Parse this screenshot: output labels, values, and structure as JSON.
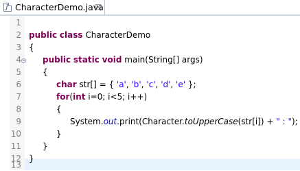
{
  "tab": {
    "title": "CharacterDemo.java",
    "close": "☒",
    "icon_letter": "J"
  },
  "line_numbers": [
    "1",
    "2",
    "3",
    "4",
    "5",
    "6",
    "7",
    "8",
    "9",
    "10",
    "11",
    "12",
    "13"
  ],
  "code": {
    "l2": {
      "kw1": "public",
      "kw2": "class",
      "name": "CharacterDemo"
    },
    "l3": {
      "text": "{"
    },
    "l4": {
      "kw1": "public",
      "kw2": "static",
      "kw3": "void",
      "rest": "main(String[] args)"
    },
    "l5": {
      "text": "{"
    },
    "l6": {
      "kw": "char",
      "pre": "str[] = { ",
      "s1": "'a'",
      "c1": ", ",
      "s2": "'b'",
      "c2": ", ",
      "s3": "'c'",
      "c3": ", ",
      "s4": "'d'",
      "c4": ", ",
      "s5": "'e'",
      "post": " };"
    },
    "l7": {
      "kw1": "for",
      "p1": "(",
      "kw2": "int",
      "rest": " i=0; i<5; i++)"
    },
    "l8": {
      "text": "{"
    },
    "l9": {
      "p1": "System.",
      "field": "out",
      "p2": ".print(Character.",
      "method": "toUpperCase",
      "p3": "(str[i]) + ",
      "str": "\" : \"",
      "p4": ");"
    },
    "l10": {
      "text": "}"
    },
    "l11": {
      "text": "}"
    },
    "l12": {
      "text": "}"
    }
  },
  "colors": {
    "keyword": "#7f0055",
    "string": "#2a00ff",
    "line_number": "#808080",
    "current_line": "#e8f2fe"
  }
}
